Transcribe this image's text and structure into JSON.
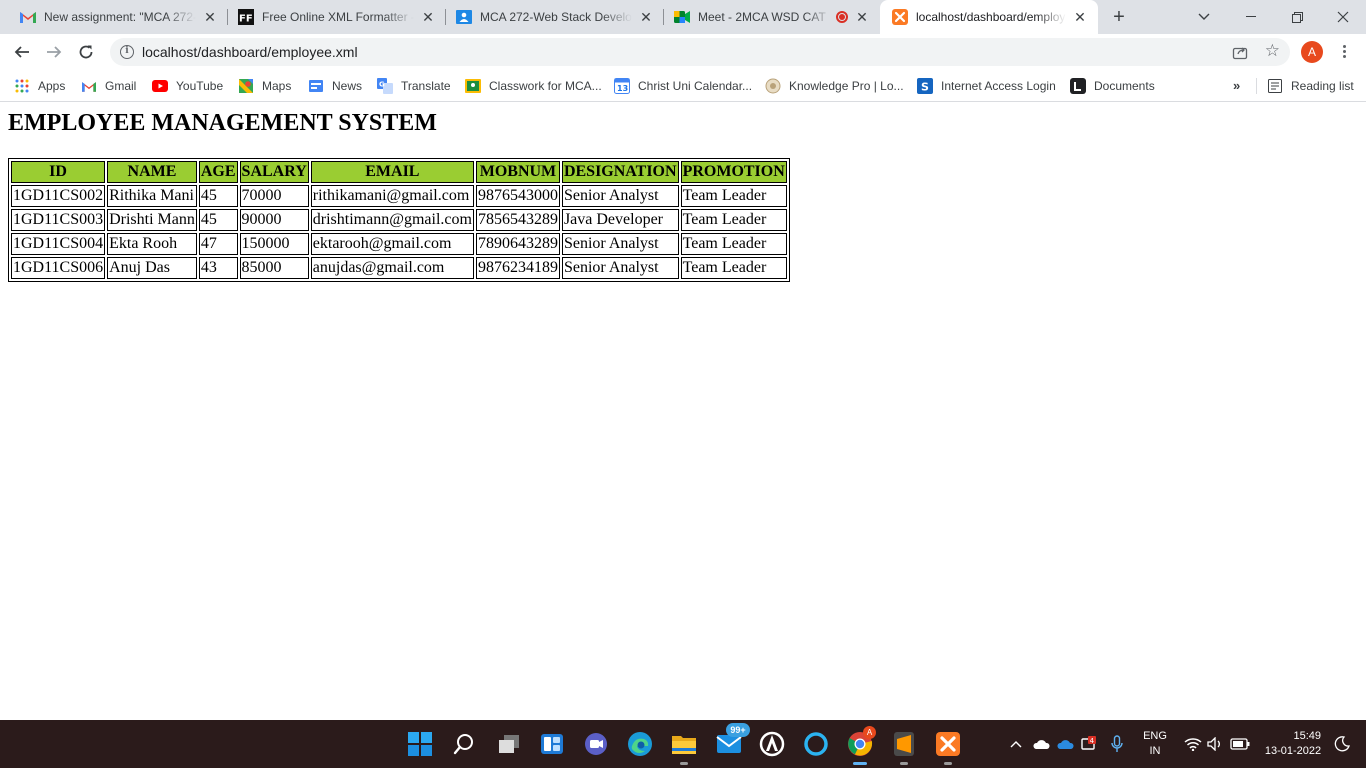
{
  "browser": {
    "tabs": [
      {
        "title": "New assignment: \"MCA 272-",
        "favicon": "gmail-icon"
      },
      {
        "title": "Free Online XML Formatter -",
        "favicon": "freeformatter-icon"
      },
      {
        "title": "MCA 272-Web Stack Develop",
        "favicon": "classroom-icon"
      },
      {
        "title": "Meet - 2MCA WSD CAT",
        "favicon": "meet-icon"
      },
      {
        "title": "localhost/dashboard/employ",
        "favicon": "xampp-icon"
      }
    ],
    "address_bar": {
      "url": "localhost/dashboard/employee.xml"
    },
    "profile_initial": "A",
    "bookmarks": [
      {
        "label": "Apps",
        "icon": "apps-grid-icon"
      },
      {
        "label": "Gmail",
        "icon": "gmail-icon"
      },
      {
        "label": "YouTube",
        "icon": "youtube-icon"
      },
      {
        "label": "Maps",
        "icon": "maps-icon"
      },
      {
        "label": "News",
        "icon": "news-icon"
      },
      {
        "label": "Translate",
        "icon": "translate-icon"
      },
      {
        "label": "Classwork for MCA...",
        "icon": "classroom-icon"
      },
      {
        "label": "Christ Uni Calendar...",
        "icon": "calendar-icon"
      },
      {
        "label": "Knowledge Pro | Lo...",
        "icon": "knowledge-pro-icon"
      },
      {
        "label": "Internet Access Login",
        "icon": "sophos-icon"
      },
      {
        "label": "Documents",
        "icon": "documents-icon"
      }
    ],
    "bookmarks_more": "»",
    "reading_list": "Reading list"
  },
  "page": {
    "heading": "EMPLOYEE MANAGEMENT SYSTEM",
    "table": {
      "headers": [
        "ID",
        "NAME",
        "AGE",
        "SALARY",
        "EMAIL",
        "MOBNUM",
        "DESIGNATION",
        "PROMOTION"
      ],
      "header_color": "#9acd32",
      "rows": [
        [
          "1GD11CS002",
          "Rithika Mani",
          "45",
          "70000",
          "rithikamani@gmail.com",
          "9876543000",
          "Senior Analyst",
          "Team Leader"
        ],
        [
          "1GD11CS003",
          "Drishti Mann",
          "45",
          "90000",
          "drishtimann@gmail.com",
          "7856543289",
          "Java Developer",
          "Team Leader"
        ],
        [
          "1GD11CS004",
          "Ekta Rooh",
          "47",
          "150000",
          "ektarooh@gmail.com",
          "7890643289",
          "Senior Analyst",
          "Team Leader"
        ],
        [
          "1GD11CS006",
          "Anuj Das",
          "43",
          "85000",
          "anujdas@gmail.com",
          "9876234189",
          "Senior Analyst",
          "Team Leader"
        ]
      ]
    }
  },
  "taskbar": {
    "mail_badge": "99+",
    "chrome_badge": "A",
    "language": "ENG",
    "region": "IN",
    "time": "15:49",
    "date": "13-01-2022"
  }
}
